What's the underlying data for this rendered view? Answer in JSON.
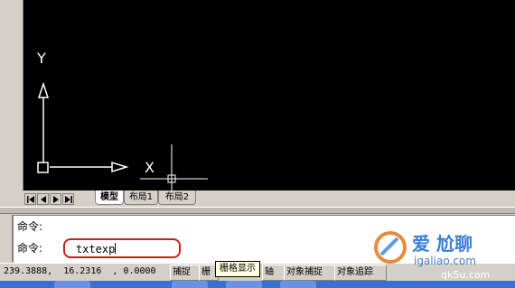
{
  "layout_tabs": {
    "model": "模型",
    "layout1": "布局1",
    "layout2": "布局2"
  },
  "axis": {
    "x_label": "X",
    "y_label": "Y"
  },
  "command": {
    "prompt1": "命令:",
    "prompt2": "命令:",
    "current_input": "txtexp"
  },
  "status": {
    "coordinates": "239.3888,  16.2316  , 0.0000",
    "snap": "捕捉",
    "grid": "栅",
    "ortho": "轴",
    "osnap": "对象捕捉",
    "otrack": "对象追踪",
    "tooltip": "栅格显示"
  },
  "watermark": {
    "line1": "爱 尬聊",
    "line2": "igaliao.com",
    "line3": "qk5u.com"
  },
  "colors": {
    "drawing_bg": "#000000",
    "highlight": "#c8211c",
    "taskbar": "#3b6fd8"
  }
}
